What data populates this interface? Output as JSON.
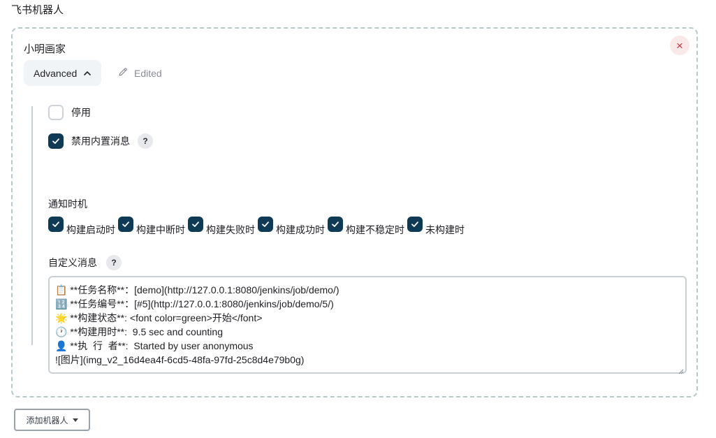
{
  "section_title": "飞书机器人",
  "robot": {
    "name": "小明画家",
    "close_icon": "×",
    "advanced_label": "Advanced",
    "edited_label": "Edited",
    "disable": {
      "label": "停用",
      "checked": false
    },
    "disable_builtin": {
      "label": "禁用内置消息",
      "checked": true,
      "help": "?"
    },
    "notify_timing": {
      "label": "通知时机",
      "options": [
        {
          "label": "构建启动时",
          "checked": true
        },
        {
          "label": "构建中断时",
          "checked": true
        },
        {
          "label": "构建失败时",
          "checked": true
        },
        {
          "label": "构建成功时",
          "checked": true
        },
        {
          "label": "构建不稳定时",
          "checked": true
        },
        {
          "label": "未构建时",
          "checked": true
        }
      ]
    },
    "custom_message": {
      "label": "自定义消息",
      "help": "?",
      "lines": [
        "📋 **任务名称**：[demo](http://127.0.0.1:8080/jenkins/job/demo/)",
        "🔢 **任务编号**：[#5](http://127.0.0.1:8080/jenkins/job/demo/5/)",
        "🌟 **构建状态**: <font color=green>开始</font>",
        "🕐 **构建用时**:  9.5 sec and counting",
        "👤 **执  行  者**:  Started by user anonymous",
        "![图片](img_v2_16d4ea4f-6cd5-48fa-97fd-25c8d4e79b0g)"
      ]
    }
  },
  "add_robot_label": "添加机器人",
  "colors": {
    "accent": "#0f3a56",
    "close": "#d0303b",
    "close_bg": "#fbe9ea",
    "border_dashed": "#b8c9cc"
  },
  "icons": {
    "close": "close-icon",
    "chevron": "chevron-up-icon",
    "edit": "pencil-icon",
    "check": "check-icon",
    "help": "question-icon",
    "caret": "caret-down-icon"
  }
}
